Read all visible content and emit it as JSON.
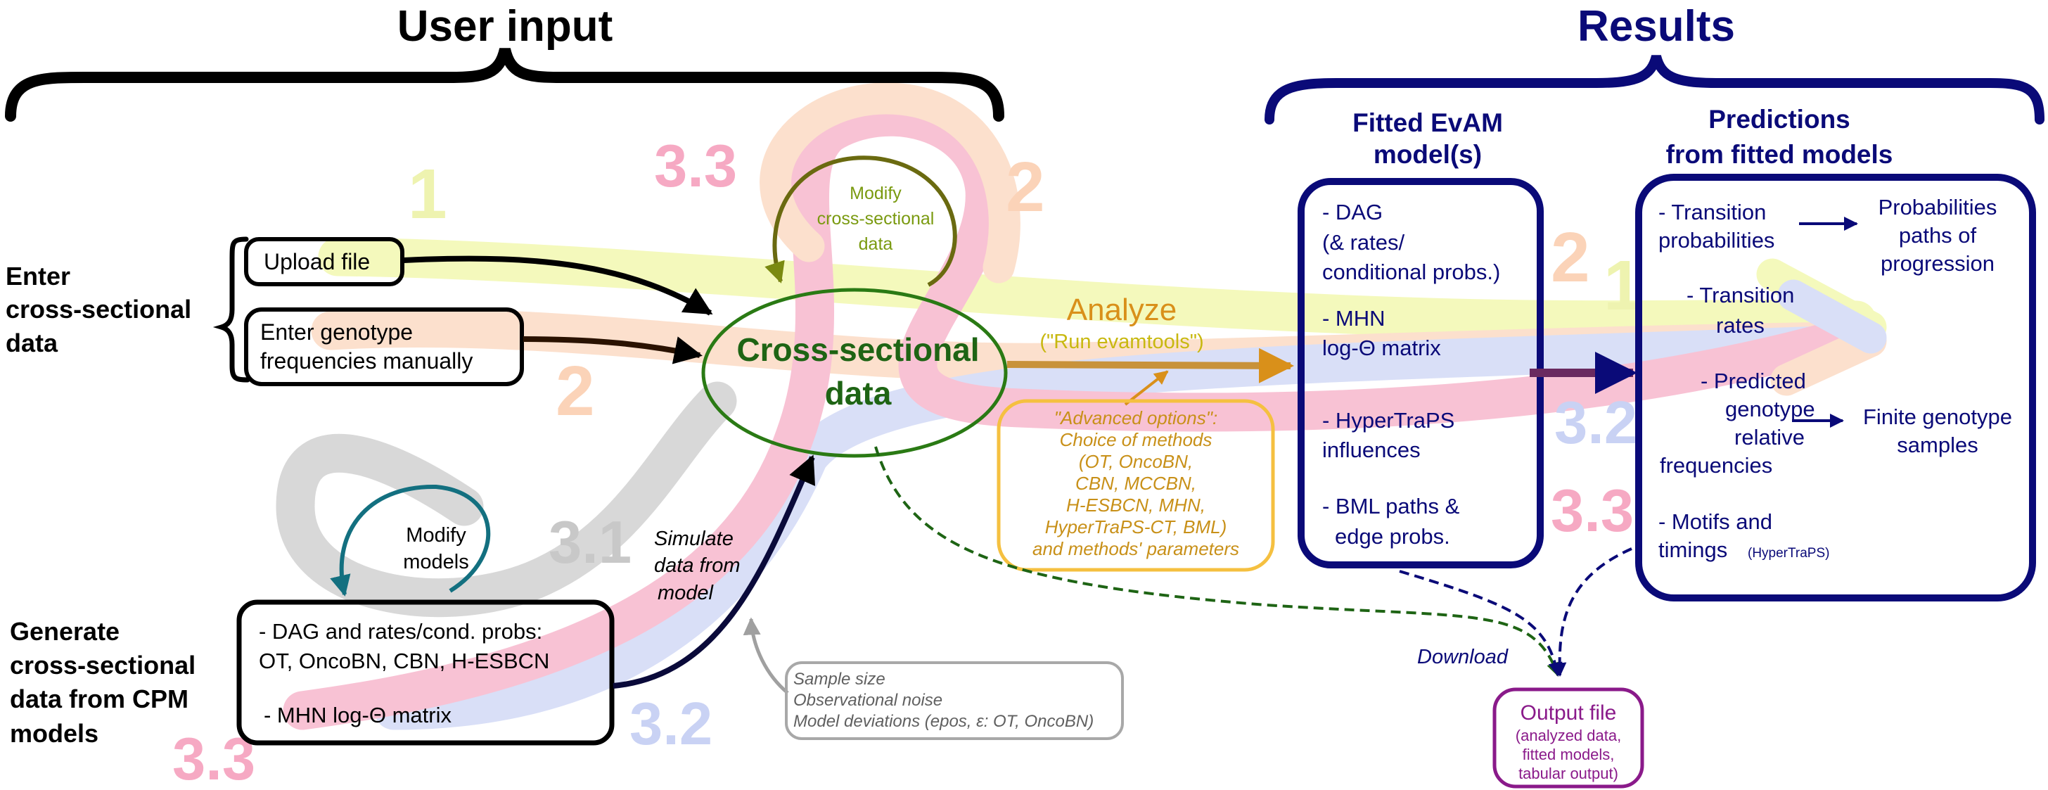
{
  "headers": {
    "user_input": "User input",
    "results": "Results"
  },
  "left": {
    "enter_lines": [
      "Enter",
      "cross-sectional",
      "data"
    ],
    "generate_lines": [
      "Generate",
      "cross-sectional",
      "data from CPM",
      "models"
    ]
  },
  "inputs": {
    "upload_file": "Upload file",
    "manual_lines": [
      "Enter genotype",
      "frequencies manually"
    ],
    "models_lines": [
      "- DAG and rates/cond. probs:",
      "OT, OncoBN, CBN, H-ESBCN"
    ],
    "mhn": "- MHN log-Θ matrix"
  },
  "center": {
    "modify_cs_lines": [
      "Modify",
      "cross-sectional",
      "data"
    ],
    "cs_lines": [
      "Cross-sectional",
      "data"
    ],
    "modify_models_lines": [
      "Modify",
      "models"
    ],
    "simulate_lines": [
      "Simulate",
      "data from",
      "model"
    ],
    "sample_lines": [
      "Sample size",
      "Observational noise",
      "Model deviations (epos, ε: OT, OncoBN)"
    ]
  },
  "analyze": {
    "title": "Analyze",
    "subtitle": "(\"Run evamtools\")",
    "advanced_lines": [
      "\"Advanced options\":",
      "Choice of methods",
      "(OT, OncoBN,",
      "CBN, MCCBN,",
      "H-ESBCN, MHN,",
      "HyperTraPS-CT, BML)",
      "and methods' parameters"
    ]
  },
  "fitted": {
    "title_lines": [
      "Fitted EvAM",
      "model(s)"
    ],
    "dag_lines": [
      "- DAG",
      "(& rates/",
      "conditional probs.)"
    ],
    "mhn_lines": [
      "- MHN",
      "log-Θ matrix"
    ],
    "hyper_lines": [
      "- HyperTraPS",
      "influences"
    ],
    "bml_lines": [
      "- BML paths &",
      "edge probs."
    ]
  },
  "predictions": {
    "title_lines": [
      "Predictions",
      "from fitted models"
    ],
    "trans_prob_lines": [
      "- Transition",
      "probabilities"
    ],
    "trans_rate_lines": [
      "- Transition",
      "rates"
    ],
    "pred_lines": [
      "- Predicted",
      "genotype",
      "relative",
      "frequencies"
    ],
    "motifs_lines": [
      "- Motifs and",
      "timings"
    ],
    "motifs_small": "(HyperTraPS)",
    "paths_lines": [
      "Probabilities",
      "paths  of",
      "progression"
    ],
    "finite_lines": [
      "Finite genotype",
      "samples"
    ]
  },
  "output": {
    "download": "Download",
    "title": "Output file",
    "lines": [
      "(analyzed data,",
      "fitted models,",
      "tabular output)"
    ]
  },
  "route_labels": {
    "r1_left": "1",
    "r2_left": "2",
    "r33_top": "3.3",
    "r2_top": "2",
    "r31": "3.1",
    "r33_bottom": "3.3",
    "r32_bottom": "3.2",
    "r2_right": "2",
    "r1_right": "1",
    "r32_right": "3.2",
    "r33_right": "3.3"
  },
  "colors": {
    "route1": "#f0f7a0",
    "route2": "#fbd3b8",
    "route3_1": "#c8c8c8",
    "route3_2": "#c9d2f4",
    "route3_3": "#f6a9c3",
    "navy": "#0a0a78",
    "green": "#1e6414",
    "olive": "#7a9a10",
    "gold": "#d9901a",
    "advanced_border": "#f5c040",
    "teal": "#137080",
    "purple": "#8a1a8a"
  }
}
